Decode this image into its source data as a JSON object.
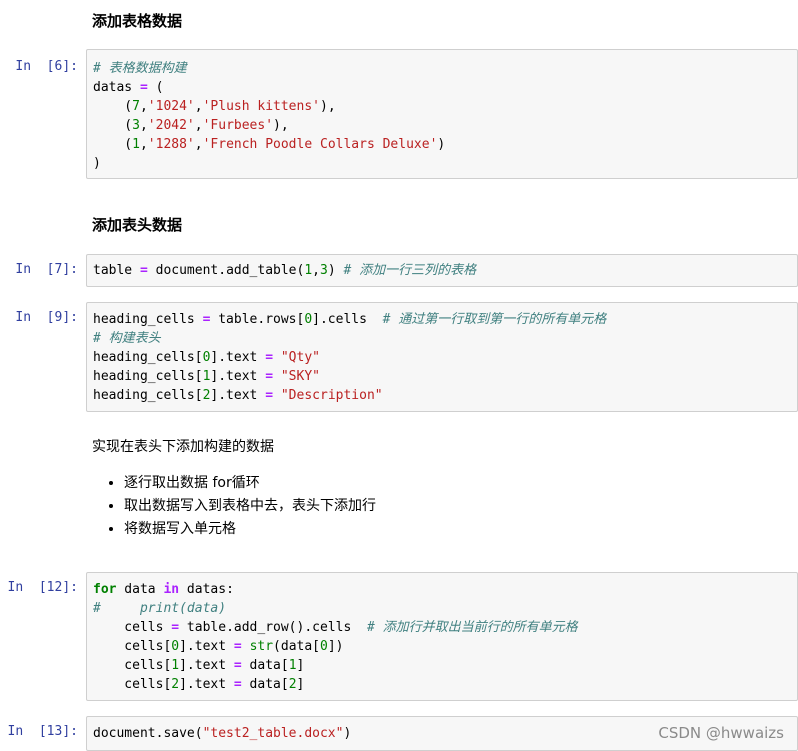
{
  "headings": {
    "add_table_data": "添加表格数据",
    "add_header_data": "添加表头数据"
  },
  "markdown": {
    "intro": "实现在表头下添加构建的数据",
    "bullets": [
      "逐行取出数据 for循环",
      "取出数据写入到表格中去，表头下添加行",
      "将数据写入单元格"
    ]
  },
  "cells": [
    {
      "prompt": "In  [6]:",
      "lines": [
        [
          [
            "cm",
            "# 表格数据构建"
          ]
        ],
        [
          [
            "",
            "datas "
          ],
          [
            "op",
            "="
          ],
          [
            "",
            " ("
          ]
        ],
        [
          [
            "",
            "    ("
          ],
          [
            "num",
            "7"
          ],
          [
            "",
            ","
          ],
          [
            "str",
            "'1024'"
          ],
          [
            "",
            ","
          ],
          [
            "str",
            "'Plush kittens'"
          ],
          [
            "",
            "),"
          ]
        ],
        [
          [
            "",
            "    ("
          ],
          [
            "num",
            "3"
          ],
          [
            "",
            ","
          ],
          [
            "str",
            "'2042'"
          ],
          [
            "",
            ","
          ],
          [
            "str",
            "'Furbees'"
          ],
          [
            "",
            "),"
          ]
        ],
        [
          [
            "",
            "    ("
          ],
          [
            "num",
            "1"
          ],
          [
            "",
            ","
          ],
          [
            "str",
            "'1288'"
          ],
          [
            "",
            ","
          ],
          [
            "str",
            "'French Poodle Collars Deluxe'"
          ],
          [
            "",
            ")"
          ]
        ],
        [
          [
            "",
            ")"
          ]
        ]
      ]
    },
    {
      "prompt": "In  [7]:",
      "lines": [
        [
          [
            "",
            "table "
          ],
          [
            "op",
            "="
          ],
          [
            "",
            " document.add_table("
          ],
          [
            "num",
            "1"
          ],
          [
            "",
            ","
          ],
          [
            "num",
            "3"
          ],
          [
            "",
            ") "
          ],
          [
            "cm",
            "# 添加一行三列的表格"
          ]
        ]
      ]
    },
    {
      "prompt": "In  [9]:",
      "lines": [
        [
          [
            "",
            "heading_cells "
          ],
          [
            "op",
            "="
          ],
          [
            "",
            " table.rows["
          ],
          [
            "num",
            "0"
          ],
          [
            "",
            "].cells  "
          ],
          [
            "cm",
            "# 通过第一行取到第一行的所有单元格"
          ]
        ],
        [
          [
            "cm",
            "# 构建表头"
          ]
        ],
        [
          [
            "",
            "heading_cells["
          ],
          [
            "num",
            "0"
          ],
          [
            "",
            "].text "
          ],
          [
            "op",
            "="
          ],
          [
            "",
            ""
          ],
          [
            "str",
            " \"Qty\""
          ]
        ],
        [
          [
            "",
            "heading_cells["
          ],
          [
            "num",
            "1"
          ],
          [
            "",
            "].text "
          ],
          [
            "op",
            "="
          ],
          [
            "str",
            " \"SKY\""
          ]
        ],
        [
          [
            "",
            "heading_cells["
          ],
          [
            "num",
            "2"
          ],
          [
            "",
            "].text "
          ],
          [
            "op",
            "="
          ],
          [
            "str",
            " \"Description\""
          ]
        ]
      ]
    },
    {
      "prompt": "In  [12]:",
      "lines": [
        [
          [
            "kw",
            "for"
          ],
          [
            "",
            " data "
          ],
          [
            "op",
            "in"
          ],
          [
            "",
            " datas:"
          ]
        ],
        [
          [
            "cm",
            "#     print(data)"
          ]
        ],
        [
          [
            "",
            "    cells "
          ],
          [
            "op",
            "="
          ],
          [
            "",
            " table.add_row().cells  "
          ],
          [
            "cm",
            "# 添加行并取出当前行的所有单元格"
          ]
        ],
        [
          [
            "",
            "    cells["
          ],
          [
            "num",
            "0"
          ],
          [
            "",
            "].text "
          ],
          [
            "op",
            "="
          ],
          [
            "",
            " "
          ],
          [
            "bi",
            "str"
          ],
          [
            "",
            "(data["
          ],
          [
            "num",
            "0"
          ],
          [
            "",
            "])"
          ]
        ],
        [
          [
            "",
            "    cells["
          ],
          [
            "num",
            "1"
          ],
          [
            "",
            "].text "
          ],
          [
            "op",
            "="
          ],
          [
            "",
            " data["
          ],
          [
            "num",
            "1"
          ],
          [
            "",
            "]"
          ]
        ],
        [
          [
            "",
            "    cells["
          ],
          [
            "num",
            "2"
          ],
          [
            "",
            "].text "
          ],
          [
            "op",
            "="
          ],
          [
            "",
            " data["
          ],
          [
            "num",
            "2"
          ],
          [
            "",
            "]"
          ]
        ]
      ]
    },
    {
      "prompt": "In  [13]:",
      "lines": [
        [
          [
            "",
            "document.save("
          ],
          [
            "str",
            "\"test2_table.docx\""
          ],
          [
            "",
            ")"
          ]
        ]
      ]
    }
  ],
  "watermark": "CSDN @hwwaizs"
}
